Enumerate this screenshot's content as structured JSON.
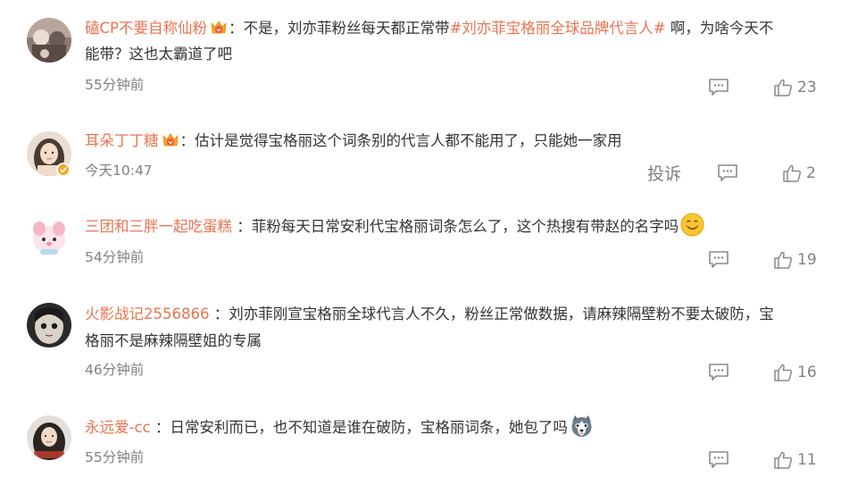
{
  "comments": [
    {
      "username": "磕CP不要自称仙粉",
      "has_badge": true,
      "colon": "：",
      "text_before_topic": "不是，刘亦菲粉丝每天都正常带",
      "topic": "#刘亦菲宝格丽全球品牌代言人#",
      "text_after_topic": " 啊，为啥今天不",
      "text_line2": "能带？这也太霸道了吧",
      "time": "55分钟前",
      "likes": "23"
    },
    {
      "username": "耳朵丁丁糖",
      "has_badge": true,
      "verified": true,
      "colon": "：",
      "text": "估计是觉得宝格丽这个词条别的代言人都不能用了，只能她一家用",
      "time": "今天10:47",
      "report": "投诉",
      "likes": "2"
    },
    {
      "username": "三团和三胖一起吃蛋糕",
      "colon": " ：",
      "text": "菲粉每天日常安利代宝格丽词条怎么了，这个热搜有带赵的名字吗",
      "emoji": "smile-emoji",
      "time": "54分钟前",
      "likes": "19"
    },
    {
      "username": "火影战记2556866",
      "colon": " ：",
      "text": "刘亦菲刚宣宝格丽全球代言人不久，粉丝正常做数据，请麻辣隔壁粉不要太破防，宝",
      "text_line2": "格丽不是麻辣隔壁姐的专属",
      "time": "46分钟前",
      "likes": "16"
    },
    {
      "username": "永远爱-cc",
      "colon": " ：",
      "text": "日常安利而已，也不知道是谁在破防，宝格丽词条，她包了吗",
      "emoji": "husky-emoji",
      "time": "55分钟前",
      "likes": "11"
    }
  ],
  "colors": {
    "username": "#eb7350",
    "topic": "#eb7350",
    "meta": "#808080",
    "text": "#333333",
    "badge": "#f5a623"
  },
  "icons": {
    "reply": "comment-bubble-icon",
    "like": "thumbs-up-icon",
    "badge": "fan-crown-badge-icon",
    "verified": "verified-check-icon"
  }
}
